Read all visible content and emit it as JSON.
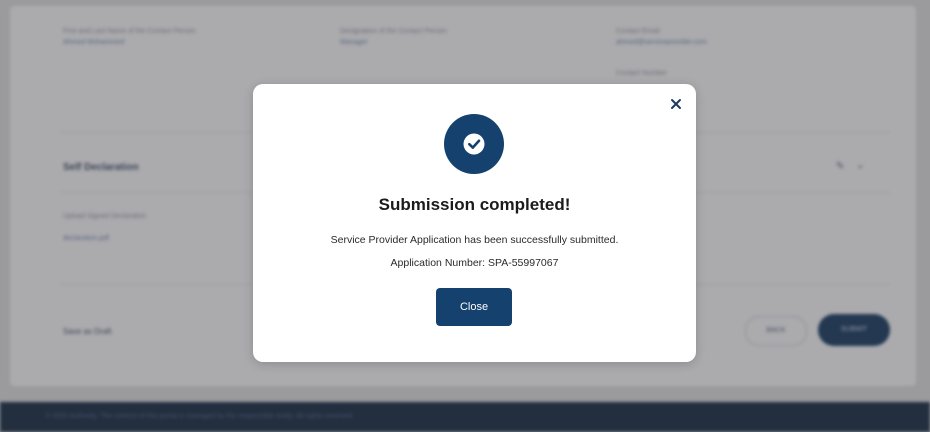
{
  "background": {
    "details": {
      "owner_name_label": "First and Last Name of the Contact Person",
      "owner_name_value": "Ahmed Mohammed",
      "designation_label": "Designation of the Contact Person",
      "designation_value": "Manager",
      "email_label": "Contact Email",
      "email_value": "ahmed@serviceprovider.com",
      "phone_label": "Contact Number"
    },
    "self_declaration": {
      "title": "Self Declaration",
      "field_label": "Upload Signed Declaration",
      "field_value": "declaration.pdf"
    },
    "actions": {
      "save_draft": "Save as Draft",
      "back": "BACK",
      "submit": "SUBMIT"
    },
    "footer": {
      "text": "© 2025 Authority. The content of this portal is managed by the responsible entity. All rights reserved."
    }
  },
  "modal": {
    "title": "Submission completed!",
    "message": "Service Provider Application has been successfully submitted.",
    "application_number": "Application Number: SPA-55997067",
    "close_button": "Close",
    "accent_color": "#14416d"
  }
}
